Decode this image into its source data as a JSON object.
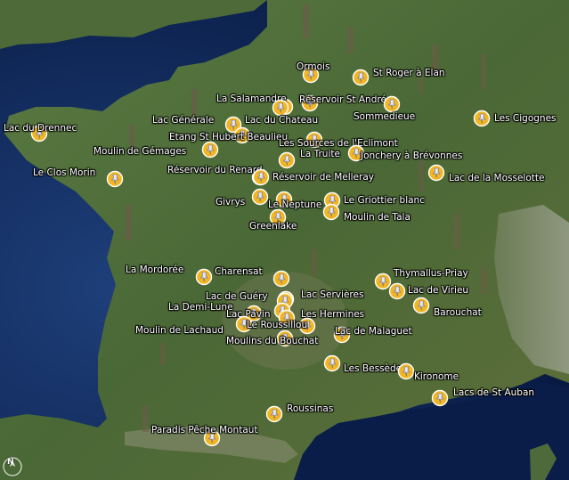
{
  "colors": {
    "sea": "#0b2150",
    "land": "#4c6a3a",
    "pin_fill": "#f2b623",
    "pin_stroke": "#ffffff",
    "label": "#ffffff"
  },
  "map": {
    "compass_letter": "N",
    "markers": [
      {
        "name": "Ormois"
      },
      {
        "name": "St Roger à Elan"
      },
      {
        "name": "La Salamandre"
      },
      {
        "name": "Réservoir St André"
      },
      {
        "name": "Sommedieue"
      },
      {
        "name": "Lac Générale"
      },
      {
        "name": "Lac du Chateau"
      },
      {
        "name": "Les Cigognes"
      },
      {
        "name": "Lac du Drennec"
      },
      {
        "name": "Etang St Hubert Beaulieu"
      },
      {
        "name": "Les Sources de l'Eclimont"
      },
      {
        "name": "Moulin de Gémages"
      },
      {
        "name": "La Truite"
      },
      {
        "name": "Jonchery à Brévonnes"
      },
      {
        "name": "Réservoir du Renard"
      },
      {
        "name": "Le Clos Morin"
      },
      {
        "name": "Réservoir de Melleray"
      },
      {
        "name": "Lac de la Mosselotte"
      },
      {
        "name": "Givrys"
      },
      {
        "name": "Le Neptune"
      },
      {
        "name": "Le Griottier blanc"
      },
      {
        "name": "Moulin de Tala"
      },
      {
        "name": "Greenlake"
      },
      {
        "name": "La Mordorée"
      },
      {
        "name": "Charensat"
      },
      {
        "name": "Thymallus-Priay"
      },
      {
        "name": "Lac de Guéry"
      },
      {
        "name": "Lac Servières"
      },
      {
        "name": "Lac de Virieu"
      },
      {
        "name": "La Demi-Lune"
      },
      {
        "name": "Lac Pavin"
      },
      {
        "name": "Les Hermines"
      },
      {
        "name": "Barouchat"
      },
      {
        "name": "Moulin de Lachaud"
      },
      {
        "name": "Le Roussillou"
      },
      {
        "name": "Lac de Malaguet"
      },
      {
        "name": "Moulins du Bouchat"
      },
      {
        "name": "Les Bessèdes"
      },
      {
        "name": "Kironome"
      },
      {
        "name": "Lacs de St Auban"
      },
      {
        "name": "Roussinas"
      },
      {
        "name": "Paradis Pêche Montaut"
      }
    ]
  }
}
